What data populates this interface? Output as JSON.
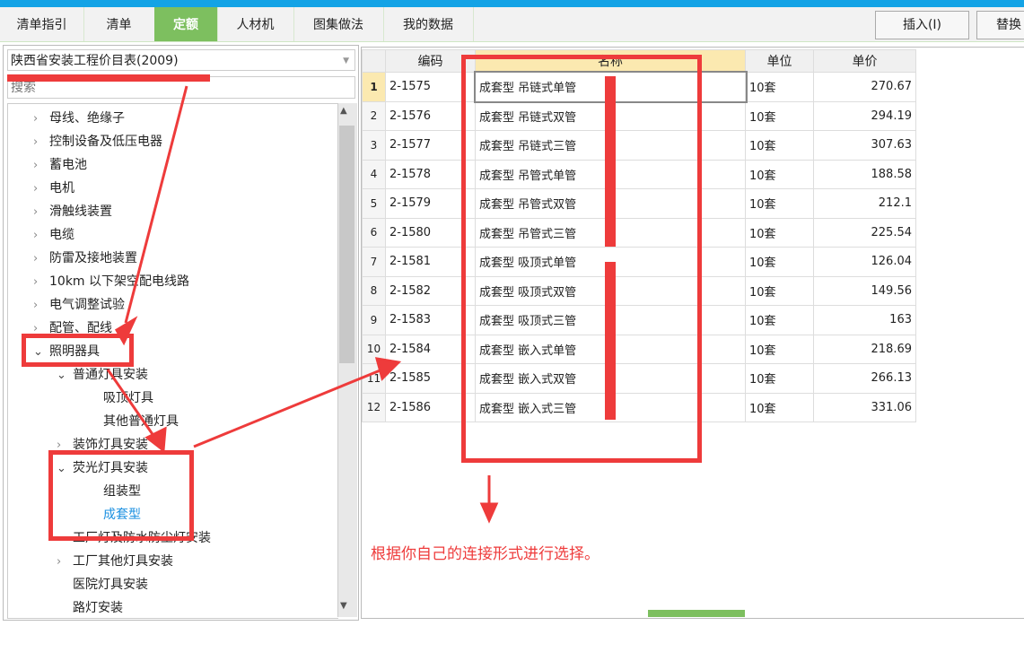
{
  "tabs": [
    "清单指引",
    "清单",
    "定额",
    "人材机",
    "图集做法",
    "我的数据"
  ],
  "active_tab": "定额",
  "buttons": {
    "insert": "插入(I)",
    "replace": "替换"
  },
  "dropdown": {
    "value": "陕西省安装工程价目表(2009)"
  },
  "search": {
    "placeholder": "搜索"
  },
  "tree": [
    {
      "label": "母线、绝缘子",
      "level": 0,
      "state": "collapsed"
    },
    {
      "label": "控制设备及低压电器",
      "level": 0,
      "state": "collapsed"
    },
    {
      "label": "蓄电池",
      "level": 0,
      "state": "collapsed"
    },
    {
      "label": "电机",
      "level": 0,
      "state": "collapsed"
    },
    {
      "label": "滑触线装置",
      "level": 0,
      "state": "collapsed"
    },
    {
      "label": "电缆",
      "level": 0,
      "state": "collapsed"
    },
    {
      "label": "防雷及接地装置",
      "level": 0,
      "state": "collapsed"
    },
    {
      "label": "10km 以下架空配电线路",
      "level": 0,
      "state": "collapsed"
    },
    {
      "label": "电气调整试验",
      "level": 0,
      "state": "collapsed"
    },
    {
      "label": "配管、配线",
      "level": 0,
      "state": "collapsed"
    },
    {
      "label": "照明器具",
      "level": 0,
      "state": "expanded"
    },
    {
      "label": "普通灯具安装",
      "level": 1,
      "state": "expanded"
    },
    {
      "label": "吸顶灯具",
      "level": 2,
      "state": "leaf"
    },
    {
      "label": "其他普通灯具",
      "level": 2,
      "state": "leaf"
    },
    {
      "label": "装饰灯具安装",
      "level": 1,
      "state": "collapsed"
    },
    {
      "label": "荧光灯具安装",
      "level": 1,
      "state": "expanded"
    },
    {
      "label": "组装型",
      "level": 2,
      "state": "leaf"
    },
    {
      "label": "成套型",
      "level": 2,
      "state": "selected"
    },
    {
      "label": "工厂灯及防水防尘灯安装",
      "level": 1,
      "state": "leaf"
    },
    {
      "label": "工厂其他灯具安装",
      "level": 1,
      "state": "collapsed"
    },
    {
      "label": "医院灯具安装",
      "level": 1,
      "state": "leaf"
    },
    {
      "label": "路灯安装",
      "level": 1,
      "state": "leaf"
    }
  ],
  "table": {
    "headers": [
      "",
      "编码",
      "名称",
      "单位",
      "单价"
    ],
    "rows": [
      [
        "1",
        "2-1575",
        "成套型 吊链式单管",
        "10套",
        "270.67"
      ],
      [
        "2",
        "2-1576",
        "成套型 吊链式双管",
        "10套",
        "294.19"
      ],
      [
        "3",
        "2-1577",
        "成套型 吊链式三管",
        "10套",
        "307.63"
      ],
      [
        "4",
        "2-1578",
        "成套型 吊管式单管",
        "10套",
        "188.58"
      ],
      [
        "5",
        "2-1579",
        "成套型 吊管式双管",
        "10套",
        "212.1"
      ],
      [
        "6",
        "2-1580",
        "成套型 吊管式三管",
        "10套",
        "225.54"
      ],
      [
        "7",
        "2-1581",
        "成套型 吸顶式单管",
        "10套",
        "126.04"
      ],
      [
        "8",
        "2-1582",
        "成套型 吸顶式双管",
        "10套",
        "149.56"
      ],
      [
        "9",
        "2-1583",
        "成套型 吸顶式三管",
        "10套",
        "163"
      ],
      [
        "10",
        "2-1584",
        "成套型 嵌入式单管",
        "10套",
        "218.69"
      ],
      [
        "11",
        "2-1585",
        "成套型 嵌入式双管",
        "10套",
        "266.13"
      ],
      [
        "12",
        "2-1586",
        "成套型 嵌入式三管",
        "10套",
        "331.06"
      ]
    ]
  },
  "annotation": {
    "note": "根据你自己的连接形式进行选择。",
    "color": "#ee3b3b"
  },
  "colors": {
    "accent": "#7dbf5f",
    "topbar": "#13a3e6",
    "selected": "#1a8fe0"
  }
}
